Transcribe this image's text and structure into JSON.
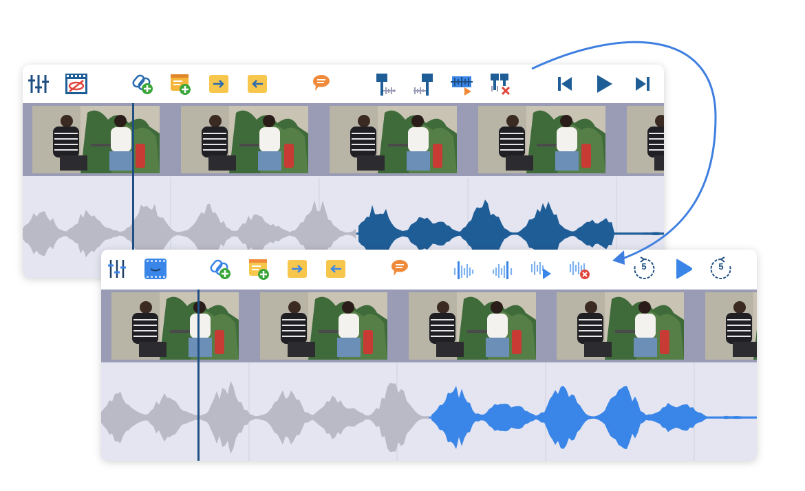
{
  "colors": {
    "old_accent": "#1f5d97",
    "new_accent": "#3a86e8",
    "muted_wave": "#b9bac6",
    "panel_bg": "#e4e5f1",
    "arrow": "#3f7fe0"
  },
  "old_editor": {
    "toolbar": [
      {
        "icon": "mixer-sliders-icon"
      },
      {
        "icon": "hide-video-icon"
      },
      {
        "icon": "add-link-icon"
      },
      {
        "icon": "add-chapter-icon"
      },
      {
        "icon": "move-right-icon"
      },
      {
        "icon": "move-left-icon"
      },
      {
        "icon": "comment-icon"
      },
      {
        "icon": "mark-in-icon"
      },
      {
        "icon": "mark-out-icon"
      },
      {
        "icon": "play-selection-icon"
      },
      {
        "icon": "delete-selection-icon"
      },
      {
        "icon": "skip-back-icon"
      },
      {
        "icon": "play-icon"
      },
      {
        "icon": "skip-forward-icon"
      }
    ],
    "frames": 5,
    "playhead_position": 0.17,
    "selection_start": 0.52
  },
  "new_editor": {
    "toolbar": [
      {
        "icon": "mixer-sliders-icon"
      },
      {
        "icon": "video-thumbnail-icon"
      },
      {
        "icon": "add-link-icon"
      },
      {
        "icon": "add-chapter-icon"
      },
      {
        "icon": "move-right-icon"
      },
      {
        "icon": "move-left-icon"
      },
      {
        "icon": "comment-icon"
      },
      {
        "icon": "mark-in-icon"
      },
      {
        "icon": "mark-out-icon"
      },
      {
        "icon": "play-selection-icon"
      },
      {
        "icon": "delete-selection-icon"
      },
      {
        "icon": "rewind-5-icon"
      },
      {
        "icon": "play-icon"
      },
      {
        "icon": "forward-5-icon"
      }
    ],
    "rewind_label": "5",
    "forward_label": "5",
    "frames": 5,
    "playhead_position": 0.15,
    "selection_start": 0.5
  }
}
